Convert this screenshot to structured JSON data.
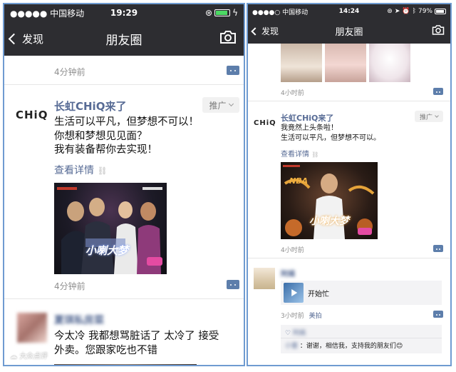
{
  "left": {
    "status": {
      "carrier": "●●●●● 中国移动",
      "time": "19:29"
    },
    "nav": {
      "back": "发现",
      "title": "朋友圈"
    },
    "post0": {
      "time": "4分钟前"
    },
    "ad": {
      "logo": "CHiQ",
      "name": "长虹CHiQ来了",
      "tag": "推广",
      "lines": [
        "生活可以平凡，但梦想不可以！",
        "你想和梦想见见面？",
        "我有装备帮你去实现！"
      ],
      "link": "查看详情",
      "poster_title": "小喇大梦",
      "time": "4分钟前"
    },
    "post2": {
      "name": "夏琪私房菜",
      "lines": [
        "今太冷 我都想骂脏话了 太冷了 接受",
        "外卖。您跟家吃也不错"
      ]
    },
    "watermark": "大众点评"
  },
  "right": {
    "status": {
      "carrier": "●●●●○ 中国移动",
      "time": "14:24",
      "battery": "79%"
    },
    "nav": {
      "back": "发现",
      "title": "朋友圈"
    },
    "post0": {
      "time": "4小时前"
    },
    "ad": {
      "logo": "CHiQ",
      "name": "长虹CHiQ来了",
      "tag": "推广",
      "lines": [
        "我竟然上头条啦！",
        "生活可以平凡，但梦想不可以。"
      ],
      "link": "查看详情",
      "poster_title": "小喇大梦",
      "poster_sub": "NBA",
      "time": "4小时前"
    },
    "post2": {
      "name": "阿嫣",
      "share": "开始忙",
      "time": "3小时前",
      "source": "美拍",
      "like_name": "阿嫣",
      "comment_name": "小蕾",
      "comment": "：谢谢，相信我，支持我的朋友们😊"
    }
  },
  "colors": {
    "nav_bg": "#2d2d31",
    "name_link": "#576b95",
    "comment_icon": "#5d7eab",
    "frame": "#6f9bd1"
  }
}
